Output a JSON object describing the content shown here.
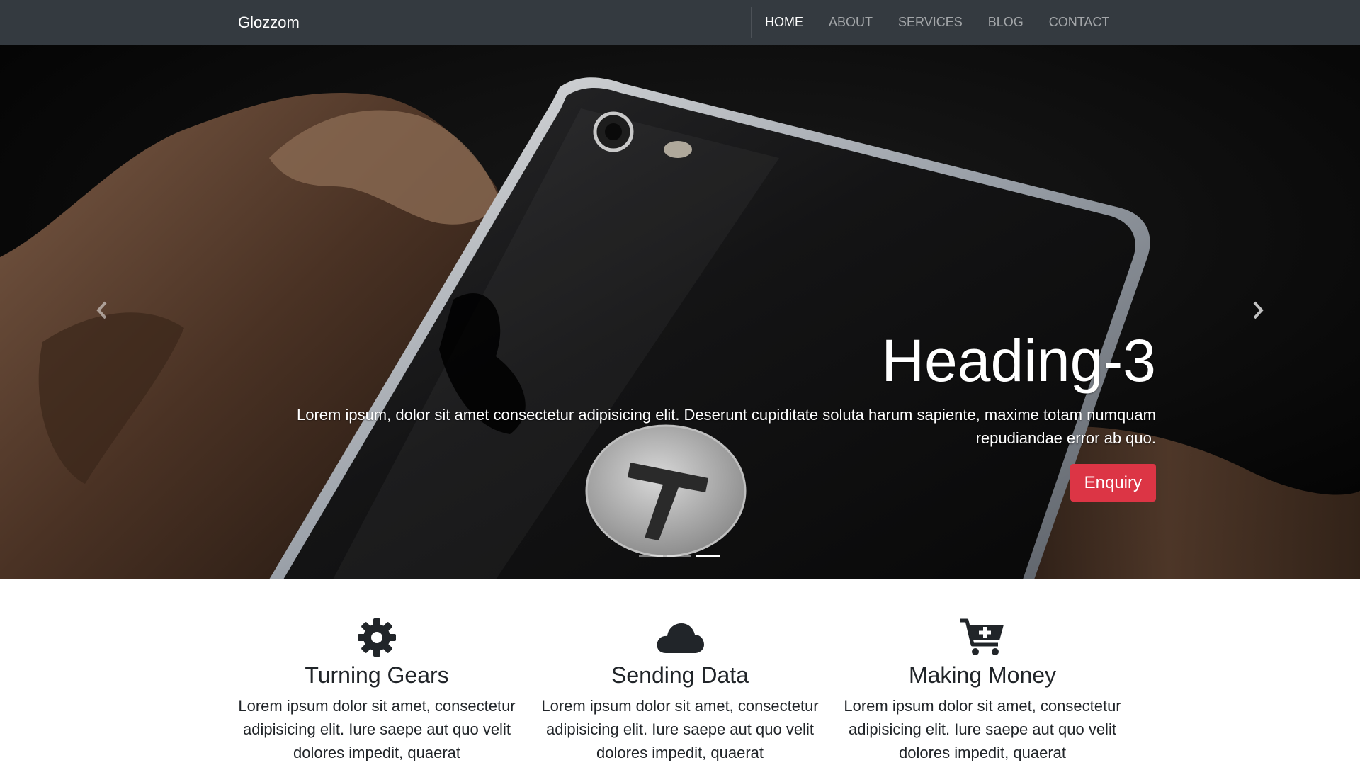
{
  "navbar": {
    "brand": "Glozzom",
    "links": [
      {
        "label": "HOME",
        "active": true
      },
      {
        "label": "ABOUT",
        "active": false
      },
      {
        "label": "SERVICES",
        "active": false
      },
      {
        "label": "BLOG",
        "active": false
      },
      {
        "label": "CONTACT",
        "active": false
      }
    ]
  },
  "carousel": {
    "slide_count": 3,
    "active_slide": 3,
    "heading": "Heading-3",
    "text": "Lorem ipsum, dolor sit amet consectetur adipisicing elit. Deserunt cupiditate soluta harum sapiente, maxime totam numquam repudiandae error ab quo.",
    "button_label": "Enquiry",
    "prev_icon": "chevron-left-icon",
    "next_icon": "chevron-right-icon"
  },
  "features": [
    {
      "icon": "gear-icon",
      "title": "Turning Gears",
      "text": "Lorem ipsum dolor sit amet, consectetur adipisicing elit. Iure saepe aut quo velit dolores impedit, quaerat"
    },
    {
      "icon": "cloud-icon",
      "title": "Sending Data",
      "text": "Lorem ipsum dolor sit amet, consectetur adipisicing elit. Iure saepe aut quo velit dolores impedit, quaerat"
    },
    {
      "icon": "cart-plus-icon",
      "title": "Making Money",
      "text": "Lorem ipsum dolor sit amet, consectetur adipisicing elit. Iure saepe aut quo velit dolores impedit, quaerat"
    }
  ],
  "colors": {
    "navbar_bg": "#343a40",
    "button_danger": "#dc3545",
    "text_dark": "#212529"
  }
}
